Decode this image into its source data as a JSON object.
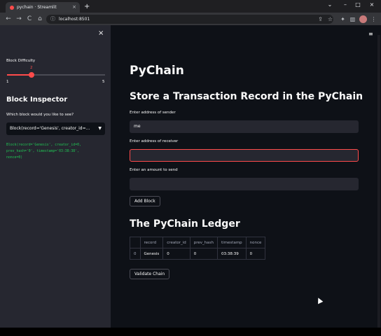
{
  "browser": {
    "tab_title": "pychain · Streamlit",
    "tab_close": "×",
    "new_tab": "+",
    "url": "localhost:8501",
    "nav_back": "←",
    "nav_forward": "→",
    "nav_reload": "C",
    "nav_home": "⌂",
    "win_min": "–",
    "win_max": "□",
    "win_close": "×"
  },
  "sidebar": {
    "close": "×",
    "difficulty_label": "Block Difficulty",
    "slider": {
      "value": "2",
      "min": "1",
      "max": "5",
      "fraction": 0.25
    },
    "inspector_title": "Block Inspector",
    "inspector_question": "Which block would you like to see?",
    "selected_block": "Block(record='Genesis', creator_id=...",
    "block_detail": "Block(record='Genesis', creator_id=0,\nprev_hash='0', timestamp='03:38:38',\nnonce=0)"
  },
  "main": {
    "menu": "≡",
    "title": "PyChain",
    "store_heading": "Store a Transaction Record in the PyChain",
    "sender_label": "Enter address of sender",
    "sender_value": "me",
    "receiver_label": "Enter address of receiver",
    "receiver_value": "",
    "amount_label": "Enter an amount to send",
    "amount_value": "",
    "add_block_button": "Add Block",
    "ledger_heading": "The PyChain Ledger",
    "ledger": {
      "columns": [
        "",
        "record",
        "creator_id",
        "prev_hash",
        "timestamp",
        "nonce"
      ],
      "rows": [
        [
          "0",
          "Genesis",
          "0",
          "0",
          "03:38:39",
          "0"
        ]
      ]
    },
    "validate_button": "Validate Chain"
  }
}
